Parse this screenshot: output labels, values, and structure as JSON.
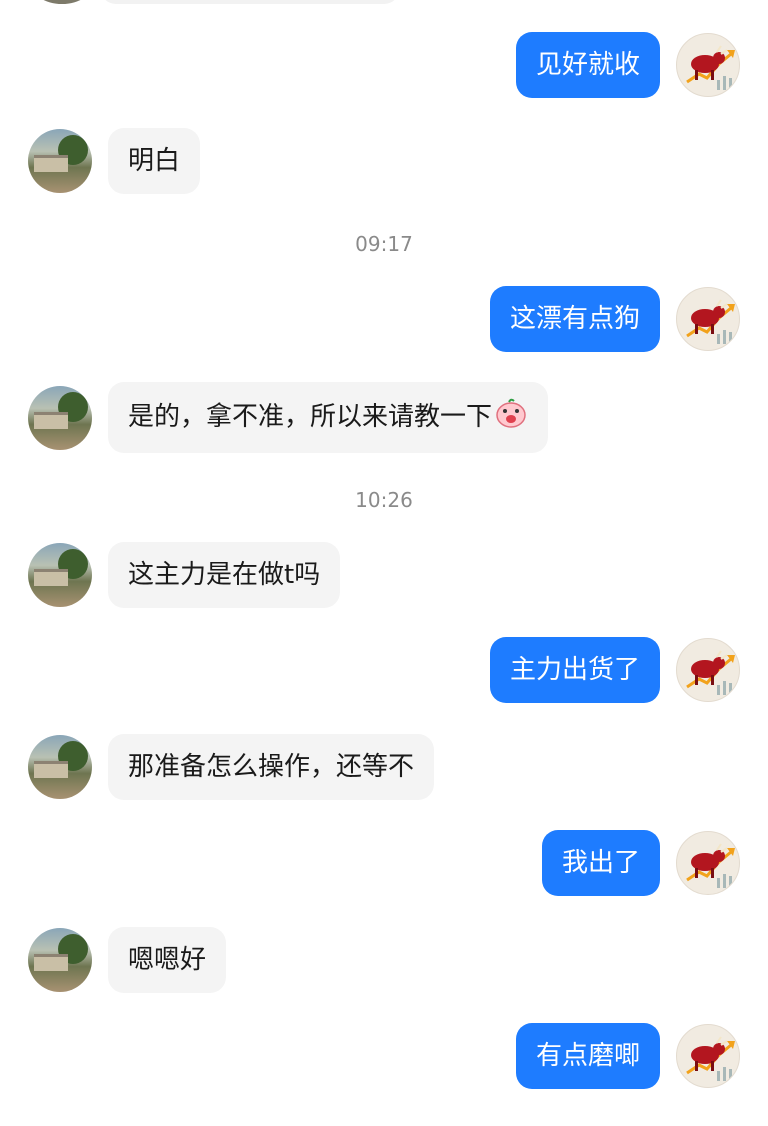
{
  "messages": [
    {
      "dir": "out",
      "text": "见好就收"
    },
    {
      "dir": "in",
      "text": "明白"
    },
    {
      "dir": "time",
      "text": "09:17"
    },
    {
      "dir": "out",
      "text": "这漂有点狗"
    },
    {
      "dir": "in",
      "text": "是的，拿不准，所以来请教一下",
      "emoji": "piglet-shocked-icon"
    },
    {
      "dir": "time",
      "text": "10:26"
    },
    {
      "dir": "in",
      "text": "这主力是在做t吗"
    },
    {
      "dir": "out",
      "text": "主力出货了"
    },
    {
      "dir": "in",
      "text": "那准备怎么操作，还等不"
    },
    {
      "dir": "out",
      "text": "我出了"
    },
    {
      "dir": "in",
      "text": "嗯嗯好"
    },
    {
      "dir": "out",
      "text": "有点磨唧"
    }
  ],
  "colors": {
    "outgoing_bubble": "#1e7cff",
    "incoming_bubble": "#f4f4f4",
    "timestamp": "#8a8a8a"
  },
  "icons": {
    "self_avatar": "bull-stock-chart-icon",
    "peer_avatar": "landscape-photo-avatar"
  }
}
